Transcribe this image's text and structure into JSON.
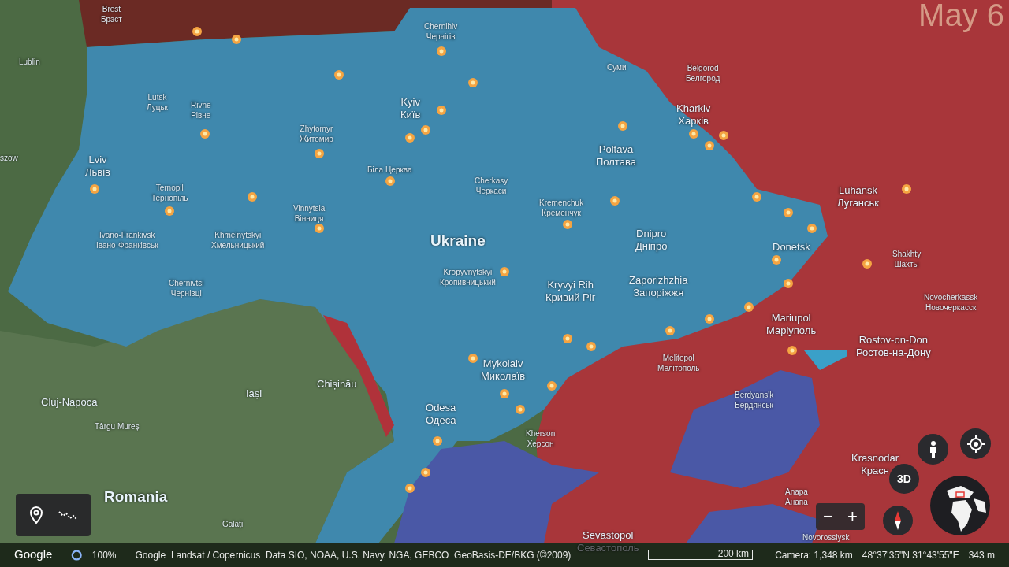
{
  "date_overlay": "May 6",
  "map": {
    "labels": [
      {
        "kind": "city",
        "name": "Brest",
        "native": "Брэст"
      },
      {
        "kind": "city",
        "name": "Chernihiv",
        "native": "Чернігів"
      },
      {
        "kind": "city",
        "name": "Lublin"
      },
      {
        "kind": "city",
        "name": "Lutsk",
        "native": "Луцьк"
      },
      {
        "kind": "city",
        "name": "Rivne",
        "native": "Рівне"
      },
      {
        "kind": "major",
        "name": "Kyiv",
        "native": "Київ"
      },
      {
        "kind": "city",
        "name": "Zhytomyr",
        "native": "Житомир"
      },
      {
        "kind": "major",
        "name": "Lviv",
        "native": "Львів"
      },
      {
        "kind": "city",
        "native": "Біла Церква"
      },
      {
        "kind": "city",
        "name": "Ternopil",
        "native": "Тернопіль"
      },
      {
        "kind": "city",
        "name": "Cherkasy",
        "native": "Черкаси"
      },
      {
        "kind": "city",
        "name": "Vinnytsia",
        "native": "Вінниця"
      },
      {
        "kind": "city",
        "name": "Ivano-Frankivsk",
        "native": "Івано-Франківськ"
      },
      {
        "kind": "city",
        "name": "Khmelnytskyi",
        "native": "Хмельницький"
      },
      {
        "kind": "country",
        "name": "Ukraine"
      },
      {
        "kind": "city",
        "name": "Kropyvnytskyi",
        "native": "Кропивницький"
      },
      {
        "kind": "city",
        "name": "Chernivtsi",
        "native": "Чернівці"
      },
      {
        "kind": "major",
        "name": "Poltava",
        "native": "Полтава"
      },
      {
        "kind": "city",
        "name": "Kremenchuk",
        "native": "Кременчук"
      },
      {
        "kind": "major",
        "name": "Dnipro",
        "native": "Дніпро"
      },
      {
        "kind": "major",
        "name": "Kryvyi Rih",
        "native": "Кривий Ріг"
      },
      {
        "kind": "major",
        "name": "Zaporizhzhia",
        "native": "Запоріжжя"
      },
      {
        "kind": "city",
        "name": "Belgorod",
        "native": "Белгород"
      },
      {
        "kind": "major",
        "name": "Kharkiv",
        "native": "Харків"
      },
      {
        "kind": "city",
        "native": "Суми"
      },
      {
        "kind": "major",
        "name": "Luhansk",
        "native": "Луганськ"
      },
      {
        "kind": "major",
        "name": "Donetsk"
      },
      {
        "kind": "city",
        "name": "Shakhty",
        "native": "Шахты"
      },
      {
        "kind": "city",
        "name": "Novocherkassk",
        "native": "Новочеркасск"
      },
      {
        "kind": "major",
        "name": "Mariupol",
        "native": "Маріуполь"
      },
      {
        "kind": "city",
        "name": "Melitopol",
        "native": "Мелітополь"
      },
      {
        "kind": "major",
        "name": "Rostov-on-Don",
        "native": "Ростов-на-Дону"
      },
      {
        "kind": "city",
        "name": "Berdyans'k",
        "native": "Бердянськ"
      },
      {
        "kind": "city",
        "name": "Kherson",
        "native": "Херсон"
      },
      {
        "kind": "major",
        "name": "Krasnodar",
        "native": "Красн"
      },
      {
        "kind": "city",
        "name": "Anapa",
        "native": "Анапа"
      },
      {
        "kind": "major",
        "name": "Sevastopol",
        "native": "Севастополь"
      },
      {
        "kind": "city",
        "name": "Novorossiysk"
      },
      {
        "kind": "major",
        "name": "Mykolaiv",
        "native": "Миколаїв"
      },
      {
        "kind": "major",
        "name": "Odesa",
        "native": "Одеса"
      },
      {
        "kind": "major",
        "name": "Chișinău"
      },
      {
        "kind": "major",
        "name": "Iași"
      },
      {
        "kind": "major",
        "name": "Cluj-Napoca"
      },
      {
        "kind": "city",
        "name": "Târgu Mureș"
      },
      {
        "kind": "country",
        "name": "Romania"
      },
      {
        "kind": "city",
        "name": "Galați"
      },
      {
        "kind": "city",
        "name": "szow"
      }
    ]
  },
  "controls": {
    "view_3d": "3D",
    "zoom_out": "−",
    "zoom_in": "+"
  },
  "status_bar": {
    "logo": "Google",
    "progress": "100%",
    "attribution": "Google  Landsat / Copernicus  Data SIO, NOAA, U.S. Navy, NGA, GEBCO  GeoBasis-DE/BKG (©2009)",
    "scale": "200 km",
    "camera": "Camera: 1,348 km",
    "coordinates": "48°37'35\"N 31°43'55\"E",
    "elevation": "343 m"
  }
}
